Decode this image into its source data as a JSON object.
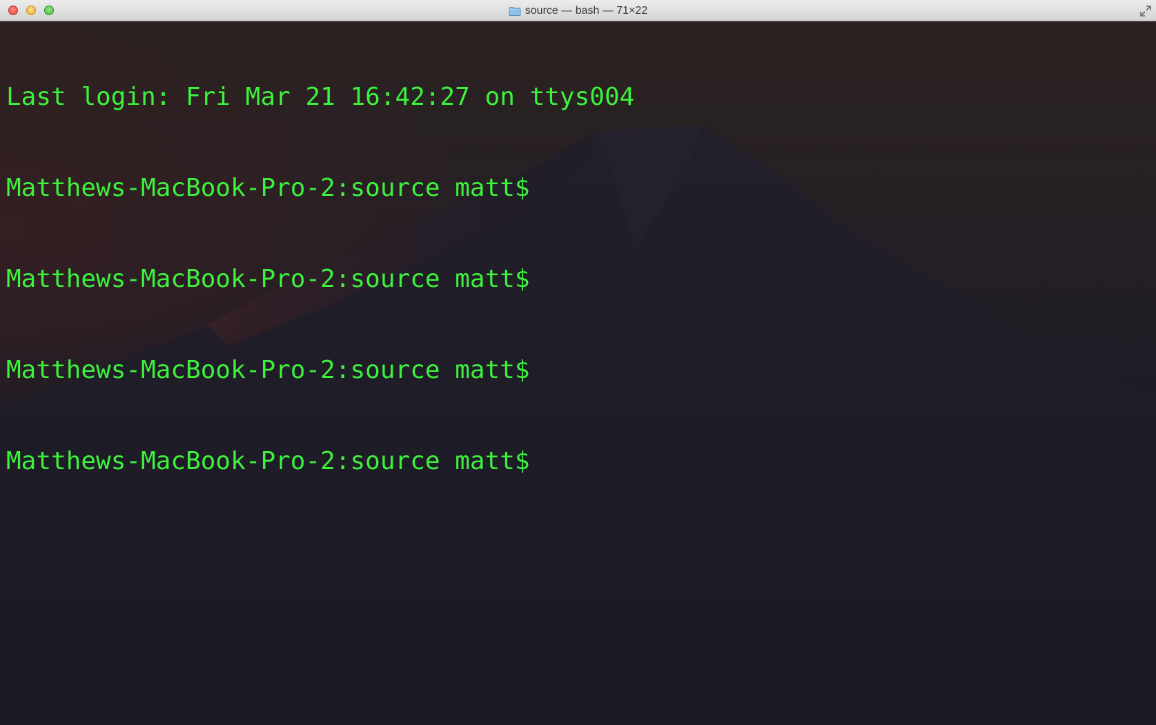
{
  "window": {
    "title": "source — bash — 71×22"
  },
  "terminal": {
    "text_color": "#3df13d",
    "background_color": "#1b1a24",
    "lines": [
      "Last login: Fri Mar 21 16:42:27 on ttys004",
      "Matthews-MacBook-Pro-2:source matt$",
      "Matthews-MacBook-Pro-2:source matt$",
      "Matthews-MacBook-Pro-2:source matt$",
      "Matthews-MacBook-Pro-2:source matt$"
    ]
  },
  "icons": {
    "title_icon": "folder-icon",
    "fullscreen": "fullscreen-arrows-icon"
  }
}
